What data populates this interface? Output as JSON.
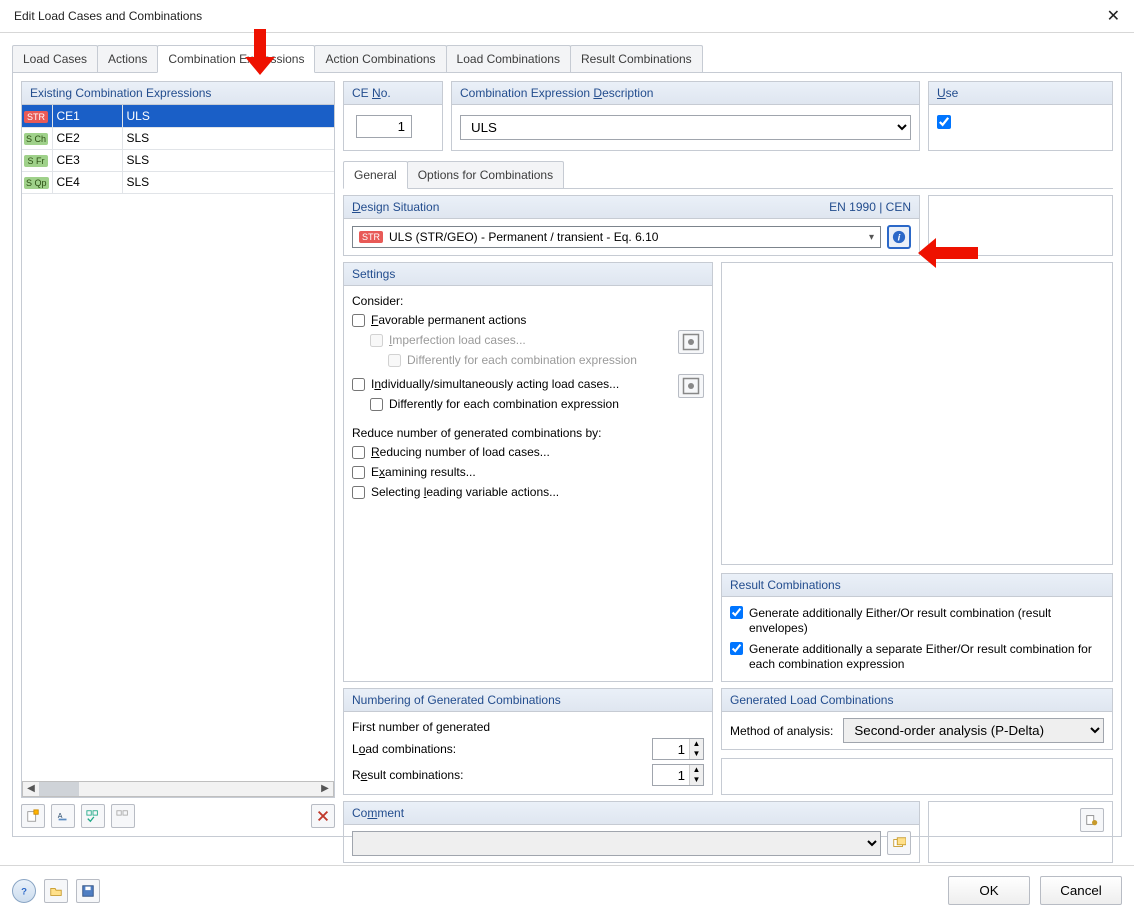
{
  "title": "Edit Load Cases and Combinations",
  "tabs": [
    "Load Cases",
    "Actions",
    "Combination Expressions",
    "Action Combinations",
    "Load Combinations",
    "Result Combinations"
  ],
  "active_tab": 2,
  "left": {
    "header": "Existing Combination Expressions",
    "rows": [
      {
        "badge": "STR",
        "cls": "b-red",
        "id": "CE1",
        "name": "ULS",
        "selected": true
      },
      {
        "badge": "S Ch",
        "cls": "b-green",
        "id": "CE2",
        "name": "SLS",
        "selected": false
      },
      {
        "badge": "S Fr",
        "cls": "b-green",
        "id": "CE3",
        "name": "SLS",
        "selected": false
      },
      {
        "badge": "S Qp",
        "cls": "b-green",
        "id": "CE4",
        "name": "SLS",
        "selected": false
      }
    ]
  },
  "ce_no_label": "CE No.",
  "ce_no_value": "1",
  "desc_label": "Combination Expression Description",
  "desc_value": "ULS",
  "use_label": "Use",
  "use_checked": true,
  "subtabs": [
    "General",
    "Options for Combinations"
  ],
  "subtab_active": 0,
  "design": {
    "label": "Design Situation",
    "standard": "EN 1990 | CEN",
    "badge": "STR",
    "value": "ULS (STR/GEO) - Permanent / transient - Eq. 6.10"
  },
  "settings": {
    "header": "Settings",
    "consider": "Consider:",
    "favorable": "Favorable permanent actions",
    "imperfection": "Imperfection load cases...",
    "diff1": "Differently for each combination expression",
    "indiv": "Individually/simultaneously acting load cases...",
    "diff2": "Differently for each combination expression",
    "reduce": "Reduce number of generated combinations by:",
    "reducing": "Reducing number of load cases...",
    "examining": "Examining results...",
    "selecting": "Selecting leading variable actions..."
  },
  "rc": {
    "header": "Result Combinations",
    "c1": "Generate additionally Either/Or result combination (result envelopes)",
    "c2": "Generate additionally a separate Either/Or result combination for each combination expression"
  },
  "glc": {
    "header": "Generated Load Combinations",
    "label": "Method of analysis:",
    "value": "Second-order analysis (P-Delta)"
  },
  "num": {
    "header": "Numbering of Generated Combinations",
    "first": "First number of generated",
    "load": "Load combinations:",
    "load_v": "1",
    "result": "Result combinations:",
    "result_v": "1"
  },
  "comment_label": "Comment",
  "ok": "OK",
  "cancel": "Cancel"
}
